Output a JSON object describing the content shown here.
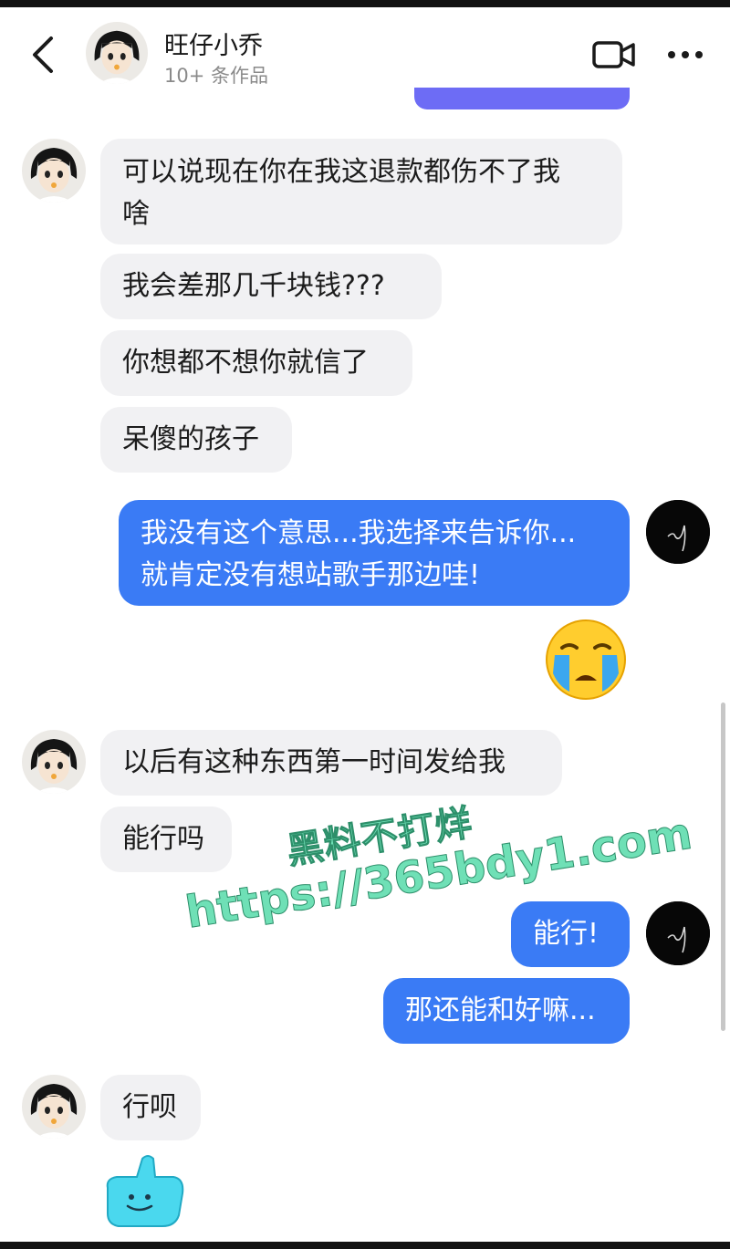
{
  "header": {
    "name": "旺仔小乔",
    "subtitle": "10+ 条作品"
  },
  "messages": {
    "m1": "可以说现在你在我这退款都伤不了我",
    "m1b": "啥",
    "m2": "我会差那几千块钱???",
    "m3": "你想都不想你就信了",
    "m4": "呆傻的孩子",
    "m5a": "我没有这个意思...我选择来告诉你...",
    "m5b": "就肯定没有想站歌手那边哇!",
    "m6": "以后有这种东西第一时间发给我",
    "m7": "能行吗",
    "m8": "能行!",
    "m9": "那还能和好嘛...",
    "m10": "行呗"
  },
  "watermark": {
    "line1": "黑料不打烊",
    "line2": "https://365bdy1.com"
  },
  "colors": {
    "incoming_bubble": "#f1f1f3",
    "outgoing_bubble": "#3a7bf5",
    "watermark": "#6fe0b6"
  },
  "icons": {
    "back": "chevron-left-icon",
    "video": "video-camera-icon",
    "more": "more-dots-icon"
  }
}
